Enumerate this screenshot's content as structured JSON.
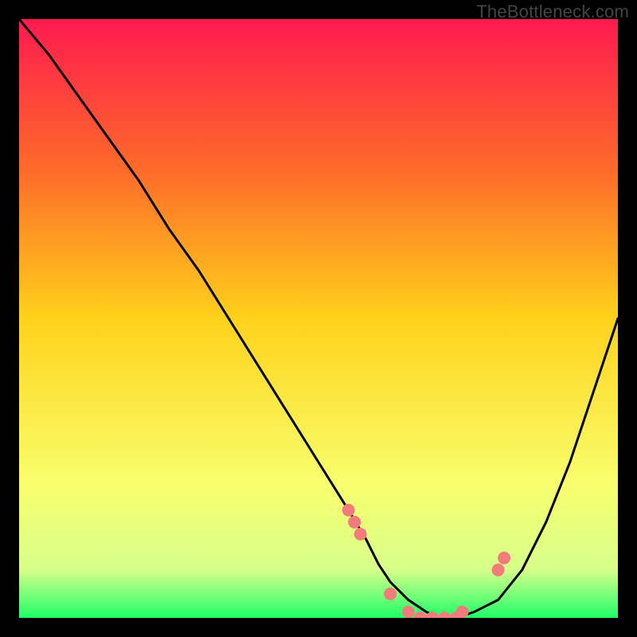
{
  "watermark": "TheBottleneck.com",
  "chart_data": {
    "type": "line",
    "title": "",
    "xlabel": "",
    "ylabel": "",
    "xlim": [
      0,
      100
    ],
    "ylim": [
      0,
      100
    ],
    "grid": false,
    "gradient_stops": [
      {
        "offset": 0,
        "color": "#ff1a4f"
      },
      {
        "offset": 25,
        "color": "#ff6a2a"
      },
      {
        "offset": 50,
        "color": "#ffd21a"
      },
      {
        "offset": 78,
        "color": "#f8ff6e"
      },
      {
        "offset": 92,
        "color": "#d6ff8a"
      },
      {
        "offset": 100,
        "color": "#1fff68"
      }
    ],
    "series": [
      {
        "name": "bottleneck-curve",
        "x": [
          0,
          5,
          10,
          15,
          20,
          25,
          30,
          35,
          40,
          45,
          50,
          55,
          58,
          60,
          62,
          65,
          68,
          70,
          73,
          76,
          80,
          84,
          88,
          92,
          96,
          100
        ],
        "y": [
          100,
          94,
          87,
          80,
          73,
          65,
          58,
          50,
          42,
          34,
          26,
          18,
          13,
          9,
          6,
          3,
          1,
          0,
          0,
          1,
          3,
          8,
          16,
          26,
          38,
          50
        ]
      }
    ],
    "markers": {
      "name": "highlight-points",
      "color": "#f47b7b",
      "x": [
        55,
        56,
        57,
        62,
        65,
        67,
        69,
        71,
        73,
        74,
        80,
        81
      ],
      "y": [
        18,
        16,
        14,
        4,
        1,
        0,
        0,
        0,
        0,
        1,
        8,
        10
      ]
    }
  }
}
